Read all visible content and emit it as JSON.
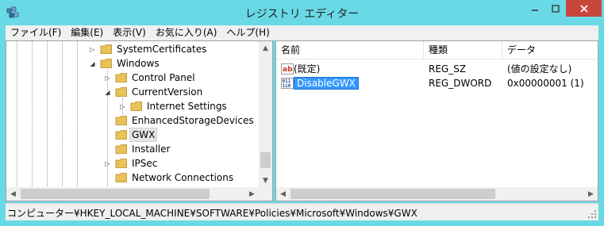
{
  "window": {
    "title": "レジストリ エディター"
  },
  "menu": [
    "ファイル(F)",
    "編集(E)",
    "表示(V)",
    "お気に入り(A)",
    "ヘルプ(H)"
  ],
  "tree": {
    "items": [
      {
        "label": "SystemCertificates",
        "expander": "▷"
      },
      {
        "label": "Windows",
        "expander": "◢"
      },
      {
        "label": "Control Panel",
        "expander": "▷"
      },
      {
        "label": "CurrentVersion",
        "expander": "◢"
      },
      {
        "label": "Internet Settings",
        "expander": "▷"
      },
      {
        "label": "EnhancedStorageDevices",
        "expander": ""
      },
      {
        "label": "GWX",
        "expander": ""
      },
      {
        "label": "Installer",
        "expander": ""
      },
      {
        "label": "IPSec",
        "expander": "▷"
      },
      {
        "label": "Network Connections",
        "expander": ""
      }
    ]
  },
  "list": {
    "headers": {
      "name": "名前",
      "type": "種類",
      "data": "データ"
    },
    "rows": [
      {
        "name": "(既定)",
        "type": "REG_SZ",
        "data": "(値の設定なし)",
        "icon": "string-value-icon"
      },
      {
        "name": "DisableGWX",
        "type": "REG_DWORD",
        "data": "0x00000001 (1)",
        "icon": "binary-value-icon"
      }
    ]
  },
  "status": {
    "path": "コンピューター¥HKEY_LOCAL_MACHINE¥SOFTWARE¥Policies¥Microsoft¥Windows¥GWX"
  },
  "colors": {
    "titlebar": "#6ad9e6",
    "close_button": "#c7463b",
    "selection": "#3399ff",
    "folder": "#e8c25a"
  }
}
